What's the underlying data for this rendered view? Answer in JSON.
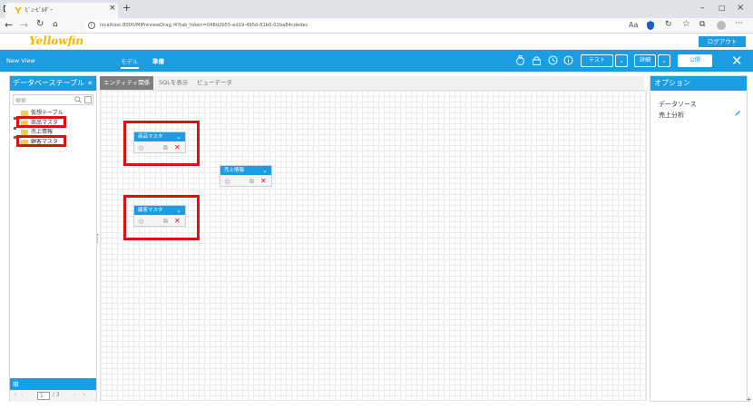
{
  "browser": {
    "tab_title": "ﾋﾞｭｰﾋﾞﾙﾀﾞｰ",
    "tab_close": "×",
    "new_tab": "+",
    "url": "localhost:8000/MIPreviewDrag.i4?tab_token=048d2b55-ed19-495d-81b0-02ba84cdedec",
    "window_controls": [
      "–",
      "□",
      "×"
    ]
  },
  "app": {
    "logo": "Yellowfin",
    "logout_label": "ログアウト",
    "view_name": "New View",
    "mode_tabs": [
      "モデル",
      "準備"
    ],
    "test_label": "テスト",
    "details_label": "詳細",
    "publish_label": "公開"
  },
  "left_panel": {
    "title": "データベーステーブル",
    "collapse_icon": "«",
    "search_placeholder": "検索",
    "items": [
      "仮想テーブル",
      "商品マスタ",
      "売上情報",
      "顧客マスタ"
    ],
    "pager": {
      "current": "1",
      "total": "/ 3"
    }
  },
  "tabs": [
    "エンティティ関係",
    "SQLを表示",
    "ビューデータ"
  ],
  "entities": [
    {
      "name": "商品マスタ"
    },
    {
      "name": "売上情報"
    },
    {
      "name": "顧客マスタ"
    }
  ],
  "right_panel": {
    "title": "オプション",
    "datasource_label": "データソース",
    "datasource_value": "売上分析"
  },
  "colors": {
    "accent": "#1a9de3",
    "highlight": "#e01010"
  }
}
